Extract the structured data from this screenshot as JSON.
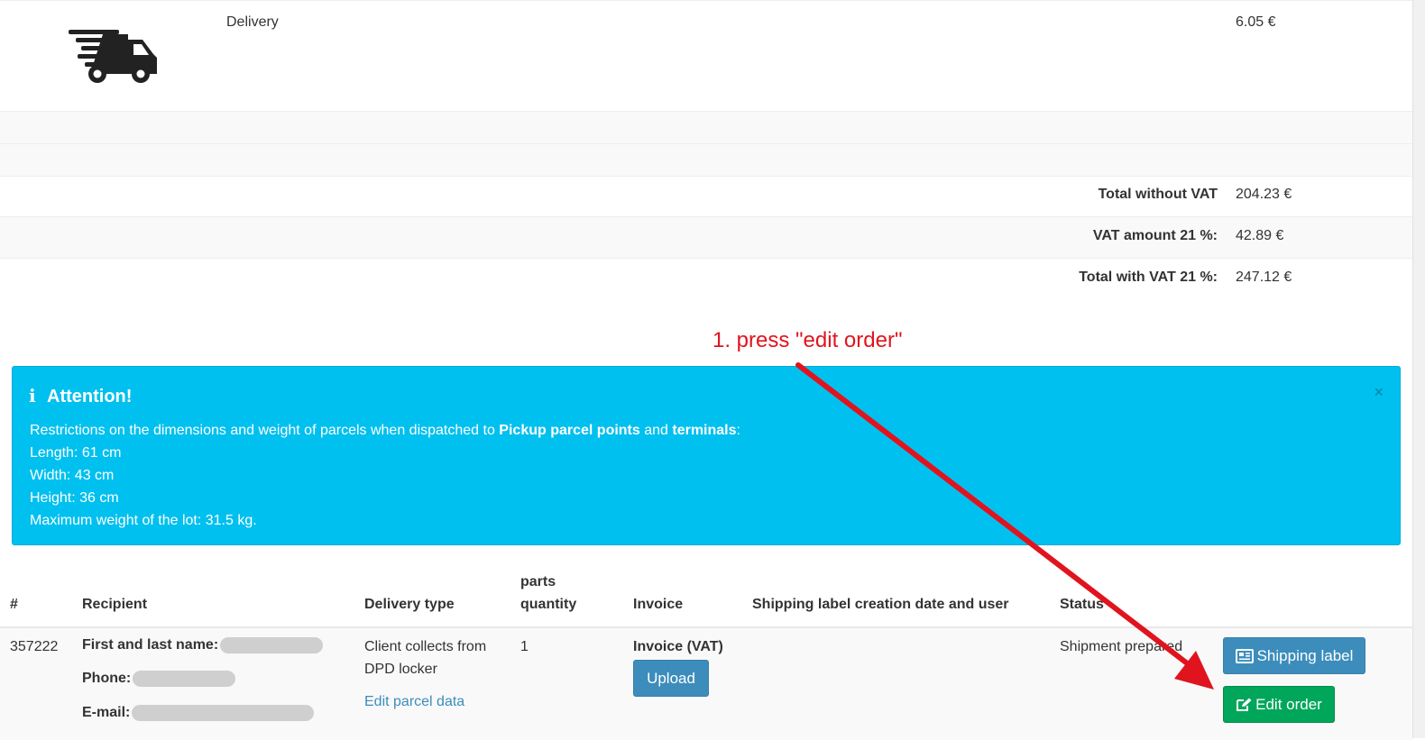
{
  "items": {
    "delivery_label": "Delivery",
    "delivery_price": "6.05 €"
  },
  "totals": [
    {
      "label": "Total without VAT",
      "value": "204.23 €"
    },
    {
      "label": "VAT amount 21 %:",
      "value": "42.89 €"
    },
    {
      "label": "Total with VAT 21 %:",
      "value": "247.12 €"
    }
  ],
  "annotation": {
    "text": "1. press \"edit order\"",
    "color": "#e0141e"
  },
  "alert": {
    "title": "Attention!",
    "intro_before": "Restrictions on the dimensions and weight of parcels when dispatched to ",
    "bold_1": "Pickup parcel points",
    "and_text": " and ",
    "bold_2": "terminals",
    "colon": ":",
    "lines": [
      "Length: 61 cm",
      "Width: 43 cm",
      "Height: 36 cm",
      "Maximum weight of the lot: 31.5 kg."
    ],
    "close": "×",
    "color": "#00c0ef"
  },
  "table": {
    "headers": {
      "num": "#",
      "recipient": "Recipient",
      "delivery_type": "Delivery type",
      "parts_line1": "parts",
      "parts_line2": "quantity",
      "invoice": "Invoice",
      "shipping_label_info": "Shipping label creation date and user",
      "status": "Status"
    },
    "row": {
      "id": "357222",
      "name_label": "First and last name:",
      "phone_label": "Phone:",
      "email_label": "E-mail:",
      "delivery_type_line1": "Client collects from",
      "delivery_type_line2": "DPD locker",
      "edit_parcel_link": "Edit parcel data",
      "quantity": "1",
      "invoice_type": "Invoice (VAT)",
      "upload_button": "Upload",
      "status": "Shipment prepared",
      "shipping_label_button": "Shipping label",
      "edit_order_button": "Edit order"
    }
  },
  "colors": {
    "primary_button": "#3c8dbc",
    "success_button": "#00a65a",
    "link": "#3c8dbc"
  }
}
